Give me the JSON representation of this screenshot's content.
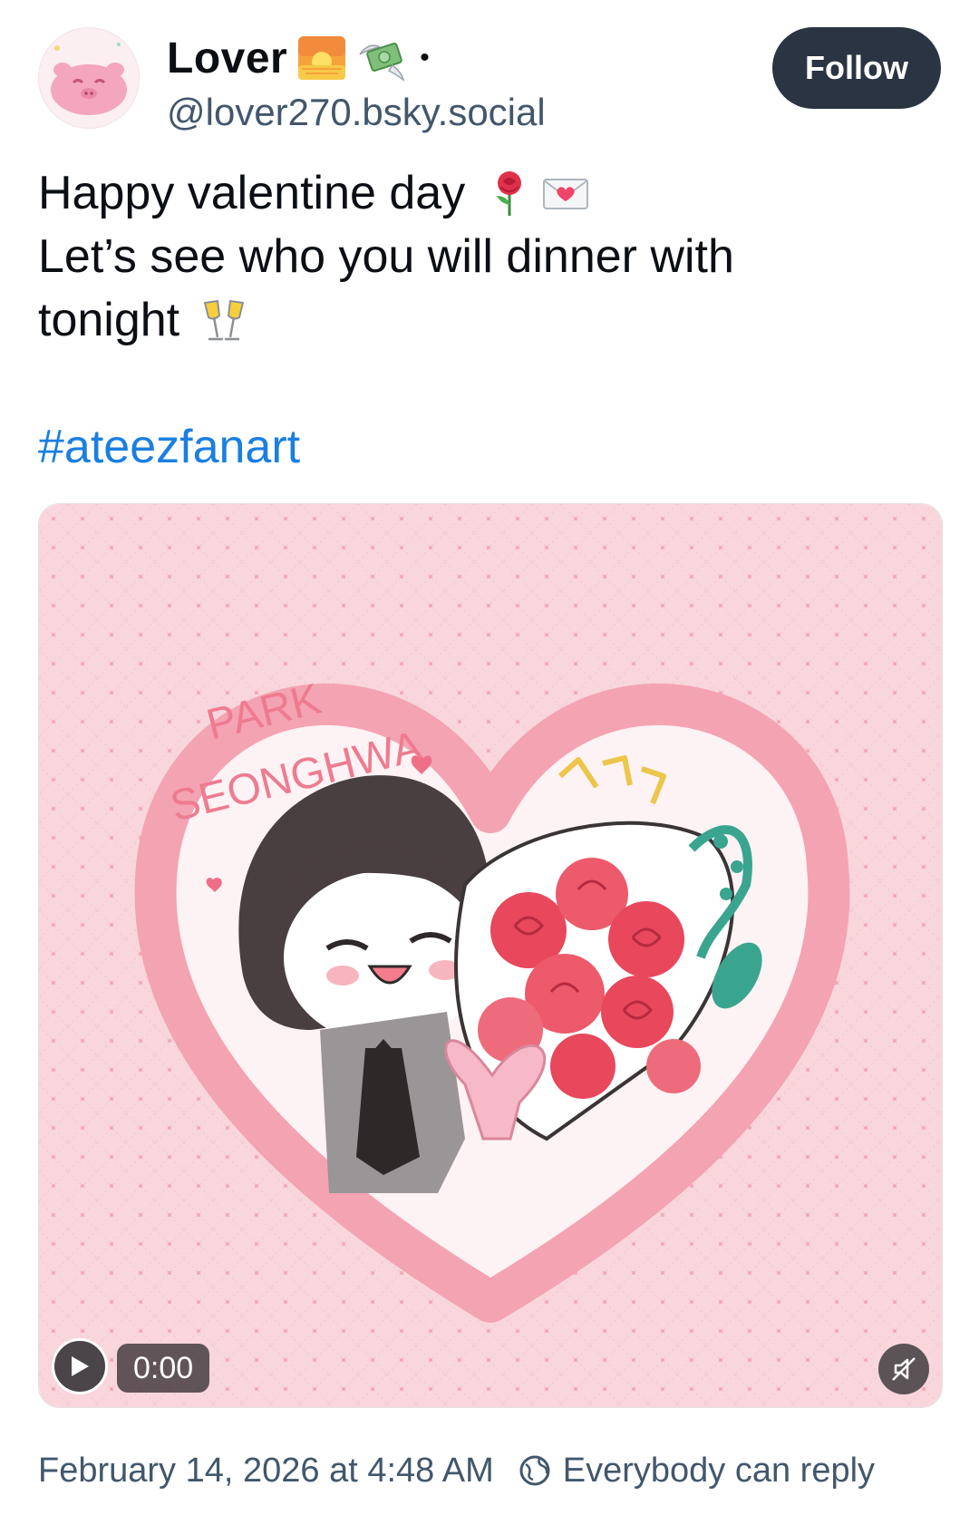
{
  "author": {
    "display_name": "Lover",
    "name_emojis": [
      "sunrise-emoji",
      "money-with-wings-emoji"
    ],
    "separator": "•",
    "handle": "@lover270.bsky.social"
  },
  "follow_label": "Follow",
  "post": {
    "line1": "Happy valentine day",
    "line1_emojis": [
      "rose-emoji",
      "love-letter-emoji"
    ],
    "line2": "Let’s see who you will dinner with",
    "line3": "tonight",
    "line3_emojis": [
      "clinking-glasses-emoji"
    ],
    "hashtag": "#ateezfanart"
  },
  "media": {
    "type": "video",
    "time": "0:00",
    "artwork_text": [
      "PARK",
      "SEONGHWA"
    ],
    "colors": {
      "background": "#f7d3d9",
      "heart": "#f29aab",
      "rose": "#e8475c",
      "leaf": "#3aa58f"
    }
  },
  "footer": {
    "timestamp": "February 14, 2026 at 4:48 AM",
    "reply_setting": "Everybody can reply"
  },
  "colors": {
    "text": "#0b0f14",
    "muted": "#42576c",
    "link": "#1a7fe0",
    "follow_bg": "#2a3442"
  }
}
